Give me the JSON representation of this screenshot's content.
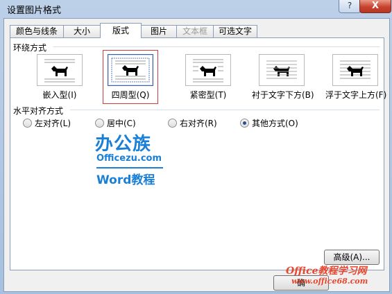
{
  "dialog": {
    "title": "设置图片格式",
    "help": "?",
    "close": "X"
  },
  "tabs": [
    {
      "label": "颜色与线条"
    },
    {
      "label": "大小"
    },
    {
      "label": "版式"
    },
    {
      "label": "图片"
    },
    {
      "label": "文本框"
    },
    {
      "label": "可选文字"
    }
  ],
  "wrap": {
    "label": "环绕方式",
    "options": [
      {
        "label": "嵌入型(I)"
      },
      {
        "label": "四周型(Q)"
      },
      {
        "label": "紧密型(T)"
      },
      {
        "label": "衬于文字下方(B)"
      },
      {
        "label": "浮于文字上方(F)"
      }
    ]
  },
  "halign": {
    "label": "水平对齐方式",
    "options": [
      {
        "label": "左对齐(L)"
      },
      {
        "label": "居中(C)"
      },
      {
        "label": "右对齐(R)"
      },
      {
        "label": "其他方式(O)"
      }
    ]
  },
  "advanced_label": "高级(A)...",
  "ok_label": "确",
  "logo": {
    "line1": "办公族",
    "line2": "Officezu.com",
    "line3": "Word教程"
  },
  "watermark": {
    "line1": "Office教程学习网",
    "line2": "www.office68.com"
  }
}
